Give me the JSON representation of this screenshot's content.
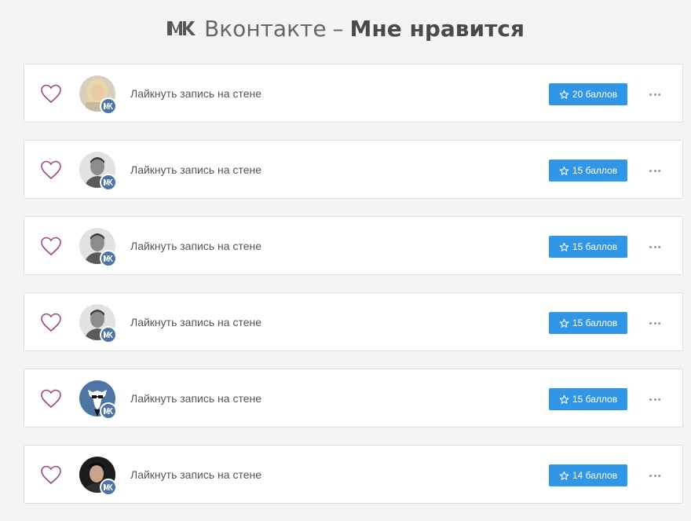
{
  "header": {
    "service": "Вконтакте",
    "separator": "–",
    "section": "Мне нравится"
  },
  "tasks": [
    {
      "label": "Лайкнуть запись на стене",
      "points": "20 баллов",
      "avatar": "female-blonde"
    },
    {
      "label": "Лайкнуть запись на стене",
      "points": "15 баллов",
      "avatar": "male-gray"
    },
    {
      "label": "Лайкнуть запись на стене",
      "points": "15 баллов",
      "avatar": "male-gray"
    },
    {
      "label": "Лайкнуть запись на стене",
      "points": "15 баллов",
      "avatar": "male-gray"
    },
    {
      "label": "Лайкнуть запись на стене",
      "points": "15 баллов",
      "avatar": "vk-dog-logo"
    },
    {
      "label": "Лайкнуть запись на стене",
      "points": "14 баллов",
      "avatar": "male-dark"
    }
  ],
  "colors": {
    "accent": "#3196e6",
    "heart": "#9c4b7c",
    "vk": "#4c75a3"
  }
}
